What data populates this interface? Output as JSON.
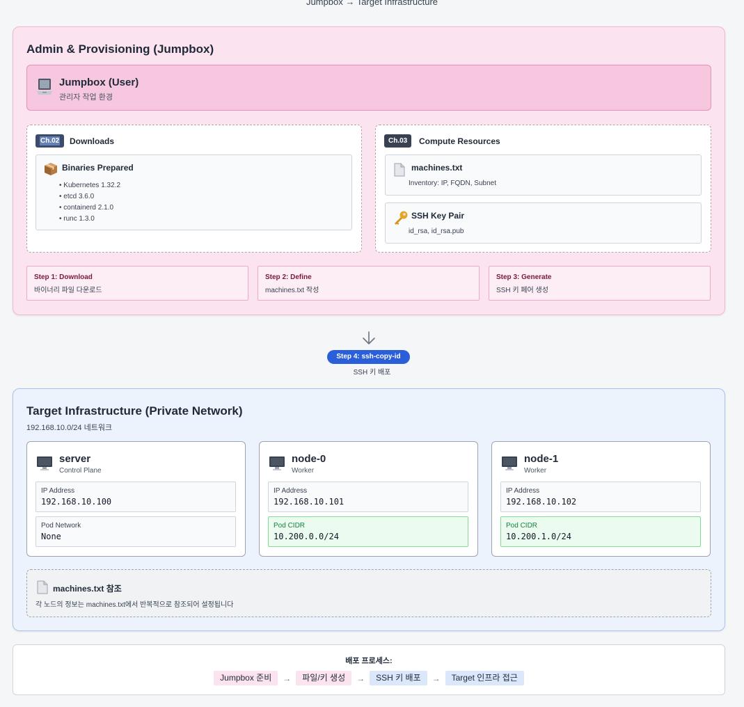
{
  "header": {
    "title": "Jumpbox → Target Infrastructure"
  },
  "admin": {
    "title": "Admin & Provisioning (Jumpbox)",
    "jumpbox": {
      "title": "Jumpbox (User)",
      "subtitle": "관리자 작업 환경",
      "icon": "laptop-icon"
    },
    "downloads": {
      "badge": "Ch.02",
      "title": "Downloads",
      "card": {
        "title": "Binaries Prepared",
        "icon": "package-icon",
        "items": [
          "Kubernetes 1.32.2",
          "etcd 3.6.0",
          "containerd 2.1.0",
          "runc 1.3.0"
        ]
      }
    },
    "compute": {
      "badge": "Ch.03",
      "title": "Compute Resources",
      "machines": {
        "title": "machines.txt",
        "subtitle": "Inventory: IP, FQDN, Subnet",
        "icon": "document-icon"
      },
      "ssh": {
        "title": "SSH Key Pair",
        "subtitle": "id_rsa, id_rsa.pub",
        "icon": "key-icon"
      }
    },
    "steps": [
      {
        "title": "Step 1: Download",
        "subtitle": "바이너리 파일 다운로드"
      },
      {
        "title": "Step 2: Define",
        "subtitle": "machines.txt 작성"
      },
      {
        "title": "Step 3: Generate",
        "subtitle": "SSH 키 페어 생성"
      }
    ]
  },
  "connector": {
    "label": "Step 4: ssh-copy-id",
    "subtitle": "SSH 키 배포"
  },
  "target": {
    "title": "Target Infrastructure (Private Network)",
    "subtitle": "192.168.10.0/24 네트워크",
    "nodes": [
      {
        "name": "server",
        "role": "Control Plane",
        "ip_label": "IP Address",
        "ip": "192.168.10.100",
        "net_label": "Pod Network",
        "net": "None"
      },
      {
        "name": "node-0",
        "role": "Worker",
        "ip_label": "IP Address",
        "ip": "192.168.10.101",
        "net_label": "Pod CIDR",
        "net": "10.200.0.0/24"
      },
      {
        "name": "node-1",
        "role": "Worker",
        "ip_label": "IP Address",
        "ip": "192.168.10.102",
        "net_label": "Pod CIDR",
        "net": "10.200.1.0/24"
      }
    ],
    "reference": {
      "title": "machines.txt 참조",
      "subtitle": "각 노드의 정보는 machines.txt에서 반복적으로 참조되어 설정됩니다"
    }
  },
  "process": {
    "title": "배포 프로세스:",
    "steps": [
      "Jumpbox 준비",
      "파일/키 생성",
      "SSH 키 배포",
      "Target 인프라 접근"
    ],
    "arrow": "→"
  },
  "colors": {
    "admin_bg": "#fbe3ef",
    "target_bg": "#edf3fc",
    "accent_blue": "#2b5fd9",
    "pod_cidr_green": "#ecfbef"
  }
}
